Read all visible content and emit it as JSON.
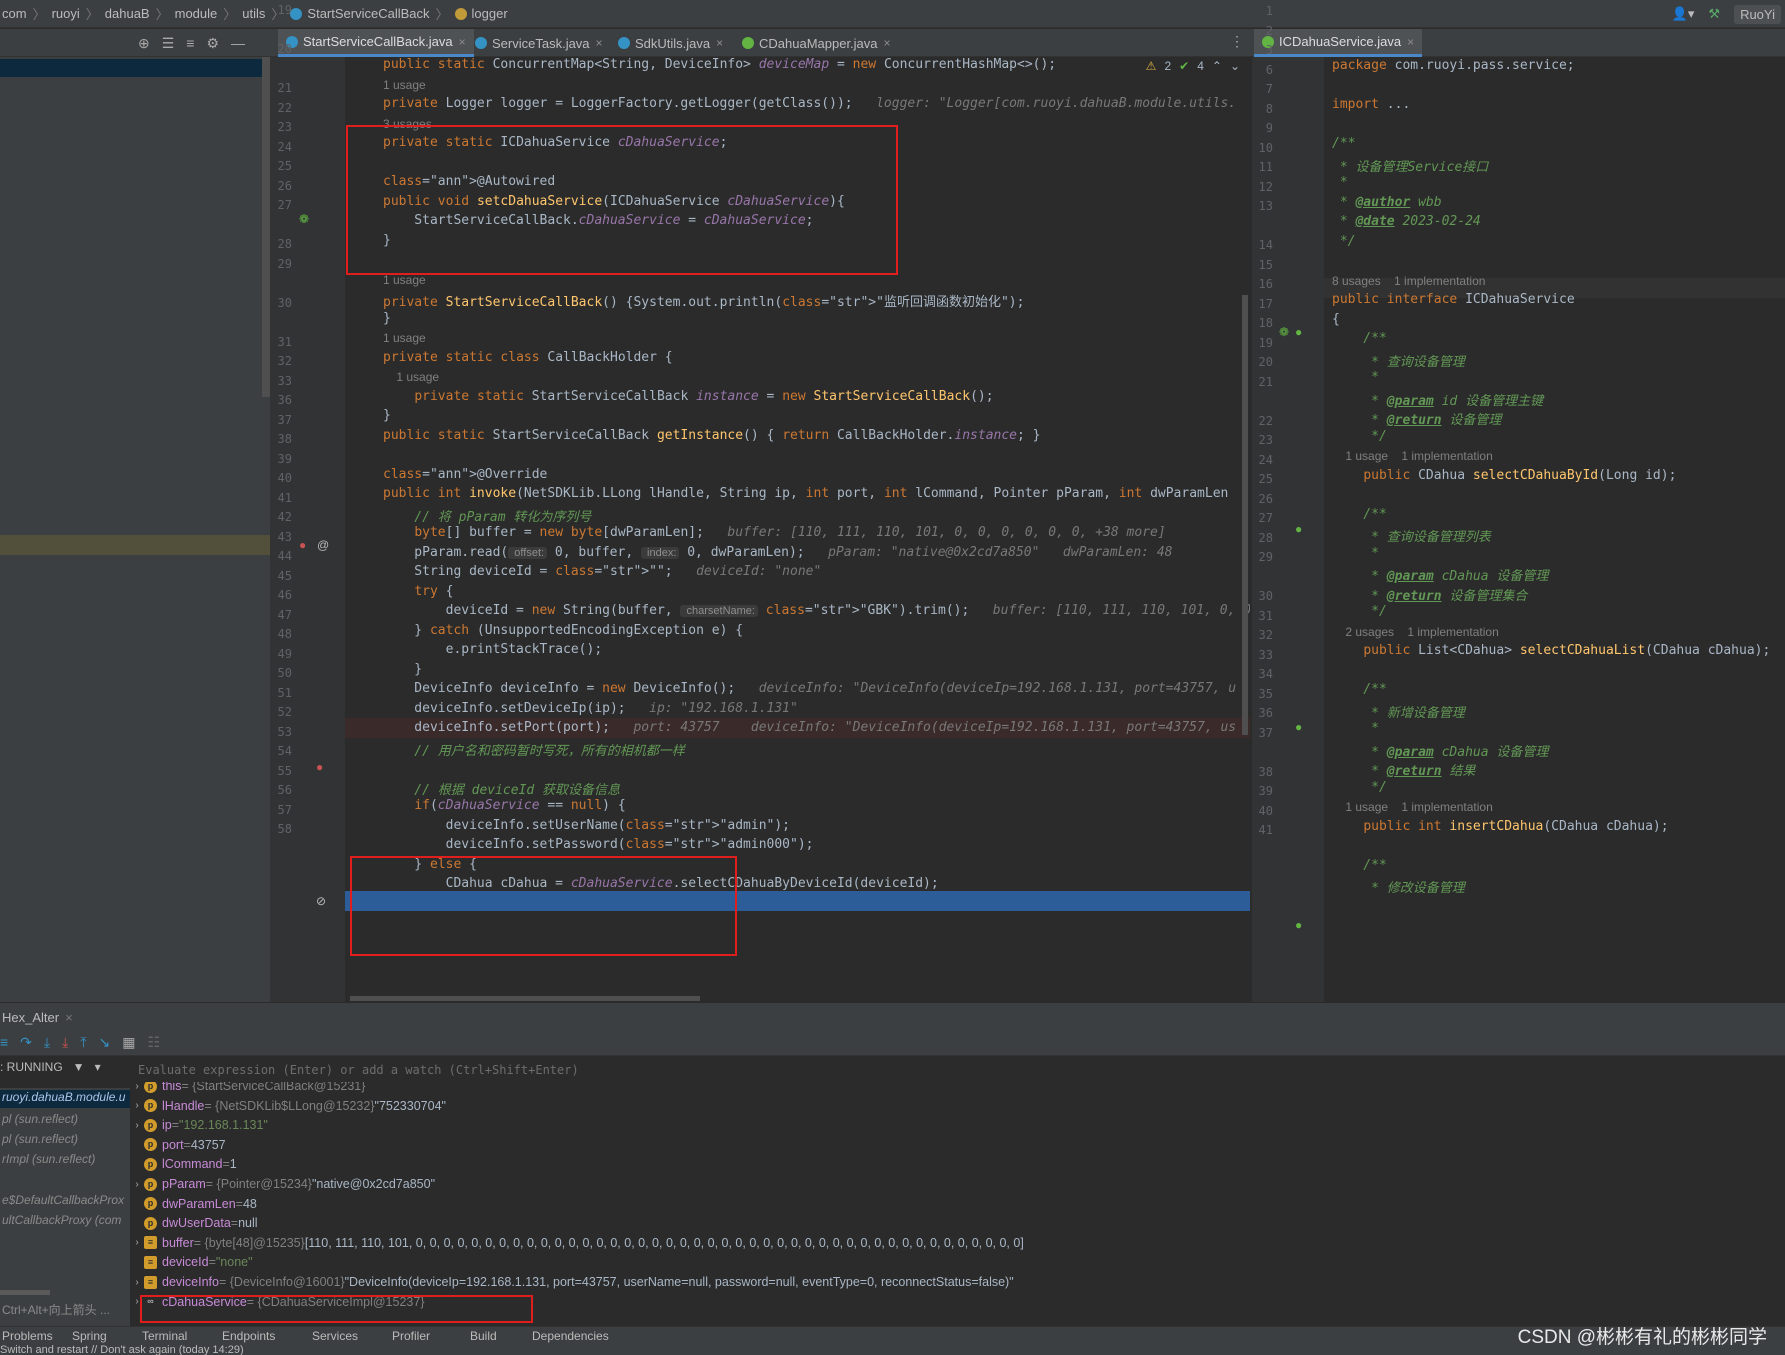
{
  "breadcrumb": [
    "com",
    "ruoyi",
    "dahuaB",
    "module",
    "utils",
    "StartServiceCallBack",
    "logger"
  ],
  "top_right": {
    "run_user": "RuoYi"
  },
  "tabs": [
    {
      "label": "StartServiceCallBack.java",
      "active": true
    },
    {
      "label": "ServiceTask.java",
      "active": false
    },
    {
      "label": "SdkUtils.java",
      "active": false
    },
    {
      "label": "CDahuaMapper.java",
      "active": false
    }
  ],
  "right_tab": {
    "label": "ICDahuaService.java"
  },
  "inspections": {
    "warnings": "2",
    "ok": "4"
  },
  "code_lines": [
    {
      "n": "19",
      "t": "public static ConcurrentMap<String, DeviceInfo> deviceMap = new ConcurrentHashMap<>();"
    },
    {
      "n": "",
      "u": "1 usage"
    },
    {
      "n": "20",
      "t": "private Logger logger = LoggerFactory.getLogger(getClass());",
      "h": "logger: \"Logger[com.ruoyi.dahuaB.module.utils."
    },
    {
      "n": "",
      "u": "3 usages"
    },
    {
      "n": "21",
      "t": "private static ICDahuaService cDahuaService;"
    },
    {
      "n": "22",
      "t": ""
    },
    {
      "n": "23",
      "t": "@Autowired"
    },
    {
      "n": "24",
      "t": "public void setcDahuaService(ICDahuaService cDahuaService){"
    },
    {
      "n": "25",
      "t": "    StartServiceCallBack.cDahuaService = cDahuaService;"
    },
    {
      "n": "26",
      "t": "}"
    },
    {
      "n": "27",
      "t": ""
    },
    {
      "n": "",
      "u": "1 usage"
    },
    {
      "n": "28",
      "t": "private StartServiceCallBack() {System.out.println(\"监听回调函数初始化\");"
    },
    {
      "n": "29",
      "t": "}"
    },
    {
      "n": "",
      "u": "1 usage"
    },
    {
      "n": "30",
      "t": "private static class CallBackHolder {"
    },
    {
      "n": "",
      "u": "    1 usage"
    },
    {
      "n": "31",
      "t": "    private static StartServiceCallBack instance = new StartServiceCallBack();"
    },
    {
      "n": "32",
      "t": "}"
    },
    {
      "n": "33",
      "t": "public static StartServiceCallBack getInstance() { return CallBackHolder.instance; }"
    },
    {
      "n": "36",
      "t": ""
    },
    {
      "n": "37",
      "t": "@Override"
    },
    {
      "n": "38",
      "t": "public int invoke(NetSDKLib.LLong lHandle, String ip, int port, int lCommand, Pointer pParam, int dwParamLen"
    },
    {
      "n": "39",
      "t": "    // 将 pParam 转化为序列号"
    },
    {
      "n": "40",
      "t": "    byte[] buffer = new byte[dwParamLen];",
      "h": "buffer: [110, 111, 110, 101, 0, 0, 0, 0, 0, 0, +38 more]"
    },
    {
      "n": "41",
      "t": "    pParam.read( offset: 0, buffer,  index: 0, dwParamLen);",
      "h": "pParam: \"native@0x2cd7a850\"   dwParamLen: 48"
    },
    {
      "n": "42",
      "t": "    String deviceId = \"\";",
      "h": "deviceId: \"none\""
    },
    {
      "n": "43",
      "t": "    try {"
    },
    {
      "n": "44",
      "t": "        deviceId = new String(buffer,  charsetName: \"GBK\").trim();",
      "h": "buffer: [110, 111, 110, 101, 0, 0, 0, 0, 0, 0"
    },
    {
      "n": "45",
      "t": "    } catch (UnsupportedEncodingException e) {"
    },
    {
      "n": "46",
      "t": "        e.printStackTrace();"
    },
    {
      "n": "47",
      "t": "    }"
    },
    {
      "n": "48",
      "t": "    DeviceInfo deviceInfo = new DeviceInfo();",
      "h": "deviceInfo: \"DeviceInfo(deviceIp=192.168.1.131, port=43757, u"
    },
    {
      "n": "49",
      "t": "    deviceInfo.setDeviceIp(ip);",
      "h": "ip: \"192.168.1.131\""
    },
    {
      "n": "50",
      "t": "    deviceInfo.setPort(port);",
      "h": "port: 43757    deviceInfo: \"DeviceInfo(deviceIp=192.168.1.131, port=43757, us"
    },
    {
      "n": "51",
      "t": "    // 用户名和密码暂时写死，所有的相机都一样"
    },
    {
      "n": "52",
      "t": ""
    },
    {
      "n": "53",
      "t": "    // 根据 deviceId 获取设备信息"
    },
    {
      "n": "54",
      "t": "    if(cDahuaService == null) {"
    },
    {
      "n": "55",
      "t": "        deviceInfo.setUserName(\"admin\");"
    },
    {
      "n": "56",
      "t": "        deviceInfo.setPassword(\"admin000\");"
    },
    {
      "n": "57",
      "t": "    } else {"
    },
    {
      "n": "58",
      "t": "        CDahua cDahua = cDahuaService.selectCDahuaByDeviceId(deviceId);"
    }
  ],
  "right_code": [
    {
      "n": "1",
      "t": "package com.ruoyi.pass.service;"
    },
    {
      "n": "2",
      "t": ""
    },
    {
      "n": "3",
      "t": "import ..."
    },
    {
      "n": "6",
      "t": ""
    },
    {
      "n": "7",
      "t": "/**"
    },
    {
      "n": "8",
      "t": " * 设备管理Service接口"
    },
    {
      "n": "9",
      "t": " *"
    },
    {
      "n": "10",
      "t": " * @author wbb"
    },
    {
      "n": "11",
      "t": " * @date 2023-02-24"
    },
    {
      "n": "12",
      "t": " */"
    },
    {
      "n": "13",
      "t": ""
    },
    {
      "n": "",
      "u": "8 usages    1 implementation"
    },
    {
      "n": "14",
      "t": "public interface ICDahuaService"
    },
    {
      "n": "15",
      "t": "{"
    },
    {
      "n": "16",
      "t": "    /**"
    },
    {
      "n": "17",
      "t": "     * 查询设备管理"
    },
    {
      "n": "18",
      "t": "     *"
    },
    {
      "n": "19",
      "t": "     * @param id 设备管理主键"
    },
    {
      "n": "20",
      "t": "     * @return 设备管理"
    },
    {
      "n": "21",
      "t": "     */"
    },
    {
      "n": "",
      "u": "    1 usage    1 implementation"
    },
    {
      "n": "22",
      "t": "    public CDahua selectCDahuaById(Long id);"
    },
    {
      "n": "23",
      "t": ""
    },
    {
      "n": "24",
      "t": "    /**"
    },
    {
      "n": "25",
      "t": "     * 查询设备管理列表"
    },
    {
      "n": "26",
      "t": "     *"
    },
    {
      "n": "27",
      "t": "     * @param cDahua 设备管理"
    },
    {
      "n": "28",
      "t": "     * @return 设备管理集合"
    },
    {
      "n": "29",
      "t": "     */"
    },
    {
      "n": "",
      "u": "    2 usages    1 implementation"
    },
    {
      "n": "30",
      "t": "    public List<CDahua> selectCDahuaList(CDahua cDahua);"
    },
    {
      "n": "31",
      "t": ""
    },
    {
      "n": "32",
      "t": "    /**"
    },
    {
      "n": "33",
      "t": "     * 新增设备管理"
    },
    {
      "n": "34",
      "t": "     *"
    },
    {
      "n": "35",
      "t": "     * @param cDahua 设备管理"
    },
    {
      "n": "36",
      "t": "     * @return 结果"
    },
    {
      "n": "37",
      "t": "     */"
    },
    {
      "n": "",
      "u": "    1 usage    1 implementation"
    },
    {
      "n": "38",
      "t": "    public int insertCDahua(CDahua cDahua);"
    },
    {
      "n": "39",
      "t": ""
    },
    {
      "n": "40",
      "t": "    /**"
    },
    {
      "n": "41",
      "t": "     * 修改设备管理"
    }
  ],
  "debug": {
    "tab_label": "Hex_Alter",
    "running_label": ": RUNNING",
    "eval_placeholder": "Evaluate expression (Enter) or add a watch (Ctrl+Shift+Enter)",
    "frames": [
      "ruoyi.dahuaB.module.u",
      "pl (sun.reflect)",
      "pl (sun.reflect)",
      "rImpl (sun.reflect)",
      "e$DefaultCallbackProx",
      "ultCallbackProxy (com"
    ],
    "frames_hint": "Ctrl+Alt+向上箭头 ...",
    "variables": [
      {
        "name": "this",
        "meta": "= {StartServiceCallBack@15231}",
        "val": ""
      },
      {
        "name": "lHandle",
        "meta": "= {NetSDKLib$LLong@15232}",
        "val": "\"752330704\""
      },
      {
        "name": "ip",
        "meta": "=",
        "val": "\"192.168.1.131\""
      },
      {
        "name": "port",
        "meta": "=",
        "val": "43757"
      },
      {
        "name": "lCommand",
        "meta": "=",
        "val": "1"
      },
      {
        "name": "pParam",
        "meta": "= {Pointer@15234}",
        "val": "\"native@0x2cd7a850\""
      },
      {
        "name": "dwParamLen",
        "meta": "=",
        "val": "48"
      },
      {
        "name": "dwUserData",
        "meta": "=",
        "val": "null"
      },
      {
        "name": "buffer",
        "meta": "= {byte[48]@15235}",
        "val": "[110, 111, 110, 101, 0, 0, 0, 0, 0, 0, 0, 0, 0, 0, 0, 0, 0, 0, 0, 0, 0, 0, 0, 0, 0, 0, 0, 0, 0, 0, 0, 0, 0, 0, 0, 0, 0, 0, 0, 0, 0, 0, 0, 0, 0, 0, 0, 0]"
      },
      {
        "name": "deviceId",
        "meta": "=",
        "val": "\"none\""
      },
      {
        "name": "deviceInfo",
        "meta": "= {DeviceInfo@16001}",
        "val": "\"DeviceInfo(deviceIp=192.168.1.131, port=43757, userName=null, password=null, eventType=0, reconnectStatus=false)\""
      },
      {
        "name": "cDahuaService",
        "meta": "= {CDahuaServiceImpl@15237}",
        "val": ""
      }
    ]
  },
  "bottom_tabs": [
    "Problems",
    "Spring",
    "Terminal",
    "Endpoints",
    "Services",
    "Profiler",
    "Build",
    "Dependencies"
  ],
  "status_text": "Switch and restart // Don't ask again (today 14:29)",
  "watermark": "CSDN @彬彬有礼的彬彬同学"
}
